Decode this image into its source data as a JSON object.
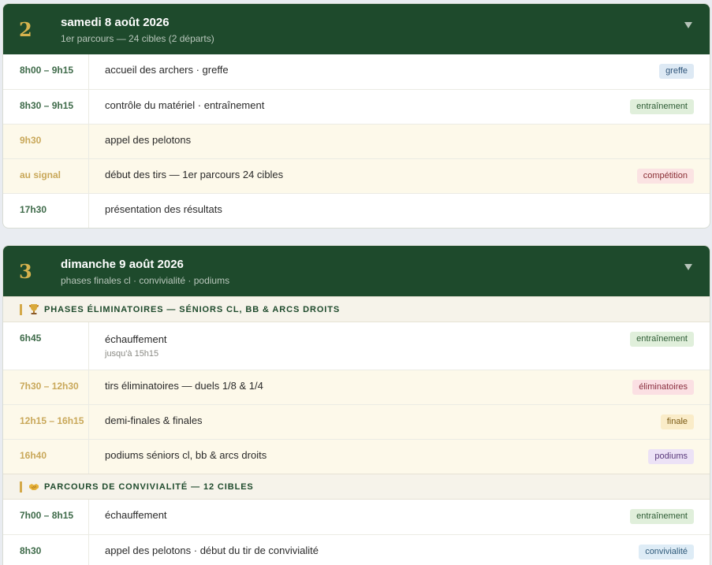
{
  "days": [
    {
      "number": "2",
      "title": "samedi 8 août 2026",
      "subtitle": "1er parcours — 24 cibles (2 départs)",
      "rows": [
        {
          "time": "8h00 – 9h15",
          "desc": "accueil des archers · greffe",
          "badge": "greffe"
        },
        {
          "time": "8h30 – 9h15",
          "desc": "contrôle du matériel · entraînement",
          "badge": "entraînement"
        },
        {
          "time": "9h30",
          "desc": "appel des pelotons",
          "badge": ""
        },
        {
          "time": "au signal",
          "desc": "début des tirs — 1er parcours 24 cibles",
          "badge": "compétition"
        },
        {
          "time": "17h30",
          "desc": "présentation des résultats",
          "badge": ""
        }
      ]
    },
    {
      "number": "3",
      "title": "dimanche 9 août 2026",
      "subtitle": "phases finales cl · convivialité · podiums",
      "sections": [
        {
          "label": "PHASES ÉLIMINATOIRES — SÉNIORS CL, BB & ARCS DROITS",
          "icon": "trophy-icon",
          "rows": [
            {
              "time": "6h45",
              "desc": "échauffement",
              "note": "jusqu'à 15h15",
              "badge": "entraînement"
            },
            {
              "time": "7h30 – 12h30",
              "desc": "tirs éliminatoires — duels 1/8 & 1/4",
              "badge": "éliminatoires"
            },
            {
              "time": "12h15 – 16h15",
              "desc": "demi-finales & finales",
              "badge": "finale"
            },
            {
              "time": "16h40",
              "desc": "podiums séniors cl, bb & arcs droits",
              "badge": "podiums"
            }
          ]
        },
        {
          "label": "PARCOURS DE CONVIVIALITÉ — 12 CIBLES",
          "icon": "handshake-icon",
          "rows": [
            {
              "time": "7h00 – 8h15",
              "desc": "échauffement",
              "badge": "entraînement"
            },
            {
              "time": "8h30",
              "desc": "appel des pelotons · début du tir de convivialité",
              "badge": "convivialité"
            }
          ]
        }
      ]
    }
  ],
  "colors": {
    "header_bg": "#1e4a2c",
    "day_number": "#d6b24e",
    "highlight_row": "#fdf9ea",
    "section_accent": "#d4a94a"
  }
}
